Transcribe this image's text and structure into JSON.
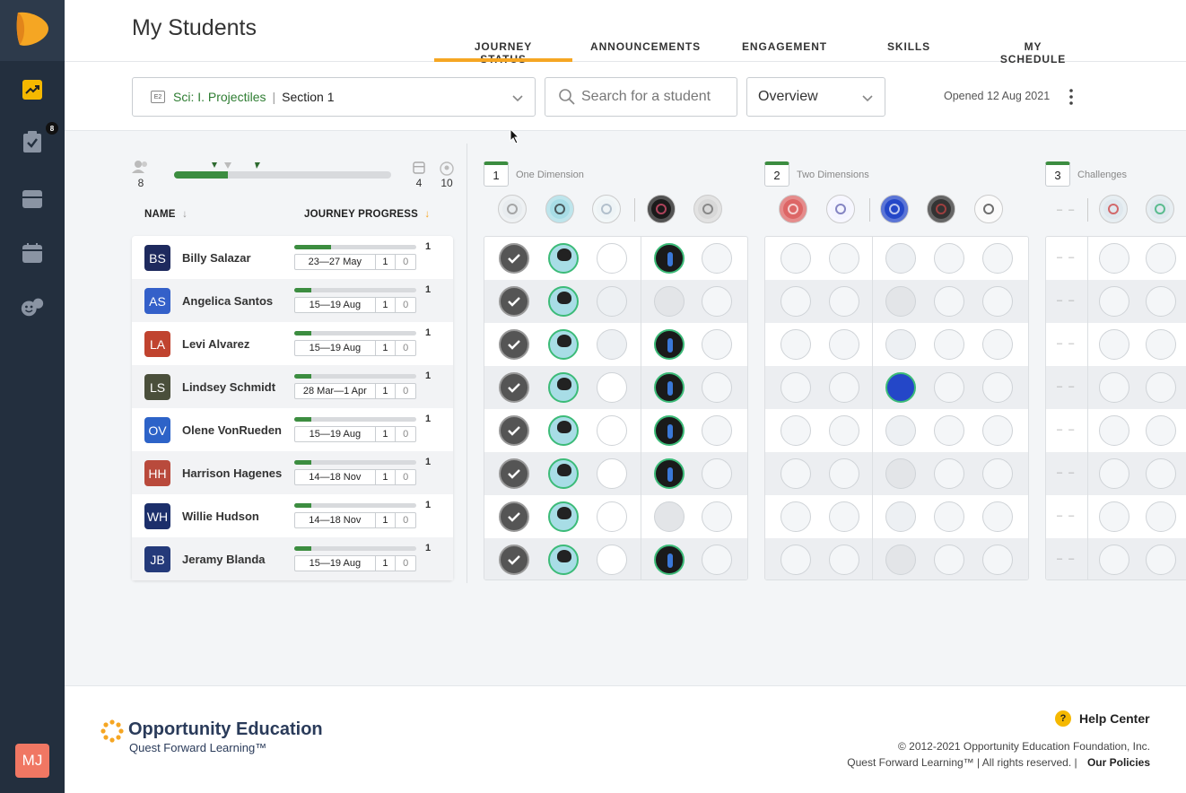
{
  "sidebar": {
    "items": [
      {
        "name": "dashboard",
        "icon": "trending-chart-icon"
      },
      {
        "name": "assignments",
        "icon": "clipboard-check-icon",
        "badge": "8"
      },
      {
        "name": "courses",
        "icon": "tray-icon"
      },
      {
        "name": "calendar",
        "icon": "calendar-icon"
      },
      {
        "name": "students",
        "icon": "faces-icon"
      }
    ],
    "user_initials": "MJ"
  },
  "header": {
    "title": "My Students",
    "tabs": [
      "JOURNEY STATUS",
      "ANNOUNCEMENTS",
      "ENGAGEMENT",
      "SKILLS",
      "MY SCHEDULE"
    ],
    "active_tab": "JOURNEY STATUS"
  },
  "toolbar": {
    "course_badge": "E2",
    "course": "Sci: I. Projectiles",
    "section": "Section 1",
    "search_placeholder": "Search for a student",
    "view": "Overview",
    "opened": "Opened 12 Aug 2021"
  },
  "summary": {
    "students": "8",
    "complete": "4",
    "total": "10"
  },
  "columns": {
    "name": "NAME",
    "progress": "JOURNEY PROGRESS"
  },
  "students": [
    {
      "initials": "BS",
      "name": "Billy Salazar",
      "color": "#1e2a5e",
      "progress": 0.3,
      "count": "1",
      "week": "23—27 May",
      "a": "1",
      "b": "0"
    },
    {
      "initials": "AS",
      "name": "Angelica Santos",
      "color": "#3460c9",
      "progress": 0.14,
      "count": "1",
      "week": "15—19 Aug",
      "a": "1",
      "b": "0"
    },
    {
      "initials": "LA",
      "name": "Levi Alvarez",
      "color": "#c0432f",
      "progress": 0.14,
      "count": "1",
      "week": "15—19 Aug",
      "a": "1",
      "b": "0"
    },
    {
      "initials": "LS",
      "name": "Lindsey Schmidt",
      "color": "#4a4f3b",
      "progress": 0.14,
      "count": "1",
      "week": "28 Mar—1 Apr",
      "a": "1",
      "b": "0"
    },
    {
      "initials": "OV",
      "name": "Olene VonRueden",
      "color": "#2d63c8",
      "progress": 0.14,
      "count": "1",
      "week": "15—19 Aug",
      "a": "1",
      "b": "0"
    },
    {
      "initials": "HH",
      "name": "Harrison Hagenes",
      "color": "#b94a3c",
      "progress": 0.14,
      "count": "1",
      "week": "14—18 Nov",
      "a": "1",
      "b": "0"
    },
    {
      "initials": "WH",
      "name": "Willie Hudson",
      "color": "#1c2f6b",
      "progress": 0.14,
      "count": "1",
      "week": "14—18 Nov",
      "a": "1",
      "b": "0"
    },
    {
      "initials": "JB",
      "name": "Jeramy Blanda",
      "color": "#243a7a",
      "progress": 0.14,
      "count": "1",
      "week": "15—19 Aug",
      "a": "1",
      "b": "0"
    }
  ],
  "sections": [
    {
      "num": "1",
      "name": "One Dimension"
    },
    {
      "num": "2",
      "name": "Two Dimensions"
    },
    {
      "num": "3",
      "name": "Challenges"
    }
  ],
  "section3_placeholder": "– –",
  "footer": {
    "brand": "Opportunity Education",
    "tagline": "Quest Forward Learning™",
    "help": "Help Center",
    "help_icon": "?",
    "copyright": "© 2012-2021 Opportunity Education Foundation, Inc.",
    "rights": "Quest Forward Learning™ | All rights reserved. |",
    "policies": "Our Policies"
  },
  "colors": {
    "accent": "#f5a623",
    "progress": "#3c8d40",
    "sidebar": "#232f3e"
  }
}
